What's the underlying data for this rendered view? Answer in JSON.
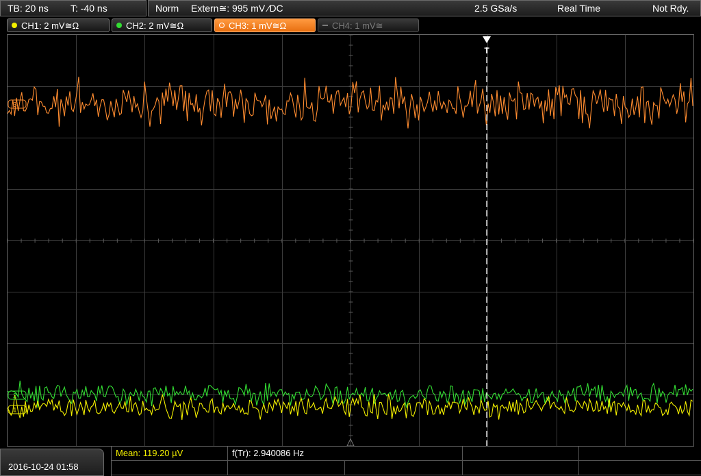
{
  "status_bar": {
    "timebase": "TB: 20 ns",
    "trigger_time": "T: -40 ns",
    "mode": "Norm",
    "trigger_source": "Extern≅: 995 mV ⁄DC",
    "sample_rate": "2.5 GSa/s",
    "acquisition": "Real Time",
    "state": "Not Rdy."
  },
  "channels": [
    {
      "label": "CH1: 2 mV≅Ω",
      "color": "#f4f000",
      "active": false,
      "enabled": true
    },
    {
      "label": "CH2: 2 mV≅Ω",
      "color": "#33dd33",
      "active": false,
      "enabled": true
    },
    {
      "label": "CH3: 1 mV≅Ω",
      "color": "#ff8c30",
      "active": true,
      "enabled": true
    },
    {
      "label": "CH4: 1 mV≅",
      "color": "#7a7a7a",
      "active": false,
      "enabled": false
    }
  ],
  "screen": {
    "trigger_marker": "T",
    "ch3_marker": "3",
    "ch2_marker": "2",
    "ch1_marker": "1",
    "colors": {
      "ch1": "#f4f000",
      "ch2": "#33dd33",
      "ch3": "#ff8c30",
      "grid": "#3c3c3c",
      "trigger": "#ffffff"
    }
  },
  "footer": {
    "datetime": "2016-10-24 01:58",
    "mean_label": "Mean: 119.20 µV",
    "freq_label": "f(Tr): 2.940086 Hz"
  }
}
